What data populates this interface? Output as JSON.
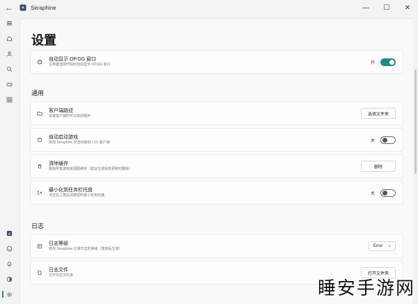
{
  "window": {
    "app_title": "Seraphine",
    "minimize": "—",
    "maximize": "☐",
    "close": "✕"
  },
  "page": {
    "title": "设置"
  },
  "top_card": {
    "title": "自动显示 OP.GG 窗口",
    "subtitle": "在英雄选择开始时自动显示 OP.GG 窗口",
    "toggle_label": "开",
    "toggle_on": true
  },
  "sections": {
    "general": "通用",
    "logs": "日志"
  },
  "general": {
    "client_path": {
      "title": "客户端路径",
      "subtitle": "设置客户端的可以启动程序",
      "button": "选择文件夹"
    },
    "auto_launch": {
      "title": "自动启动游戏",
      "subtitle": "启动 Seraphine 时自动启动 LOL 客户端",
      "toggle_label": "关",
      "toggle_on": false
    },
    "clear_cache": {
      "title": "清除缓存",
      "subtitle": "删除所有游戏资源图缓存（建议在游戏有更新时删除）",
      "button": "删除"
    },
    "minimize_tray": {
      "title": "最小化到任务栏托盘",
      "subtitle": "点击右上角关闭按钮时最小化到托盘",
      "toggle_label": "关",
      "toggle_on": false
    }
  },
  "logs": {
    "log_level": {
      "title": "日志等级",
      "subtitle": "修改 Seraphine 记录日志的等级（重启后生效）",
      "value": "Error"
    },
    "log_file": {
      "title": "日志文件",
      "subtitle": "打开日志文件夹",
      "button": "打开文件夹"
    }
  },
  "watermark": "睡安手游网",
  "colors": {
    "accent": "#1f8a8a",
    "background": "#f3f3f3",
    "card": "#fdfdfd"
  }
}
